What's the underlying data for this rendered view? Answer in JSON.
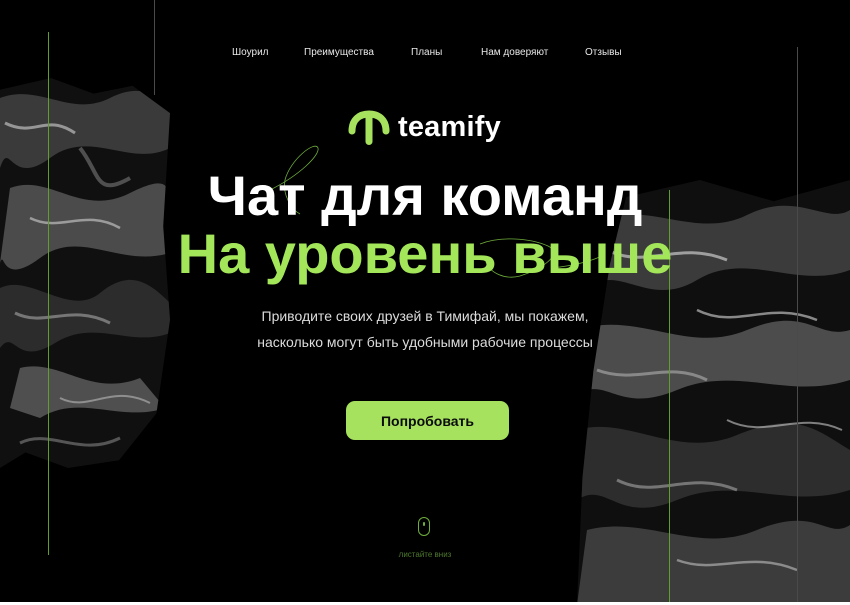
{
  "nav": {
    "items": [
      {
        "label": "Шоурил"
      },
      {
        "label": "Преимущества"
      },
      {
        "label": "Планы"
      },
      {
        "label": "Нам доверяют"
      },
      {
        "label": "Отзывы"
      }
    ]
  },
  "brand": {
    "name": "teamify"
  },
  "hero": {
    "title_line1": "Чат для команд",
    "title_line2": "На уровень выше",
    "subtitle_line1": "Приводите своих друзей в Тимифай, мы покажем,",
    "subtitle_line2": "насколько могут быть удобными рабочие процессы",
    "cta_label": "Попробовать"
  },
  "scroll": {
    "hint": "листайте вниз"
  },
  "colors": {
    "background": "#000000",
    "accent": "#a6e25e",
    "headline_accent": "#a3e65a",
    "line_green": "#5f9e2d",
    "line_gray": "#4a4a4a"
  },
  "icons": {
    "logo": "teamify-logo-icon",
    "scroll": "mouse-icon"
  }
}
